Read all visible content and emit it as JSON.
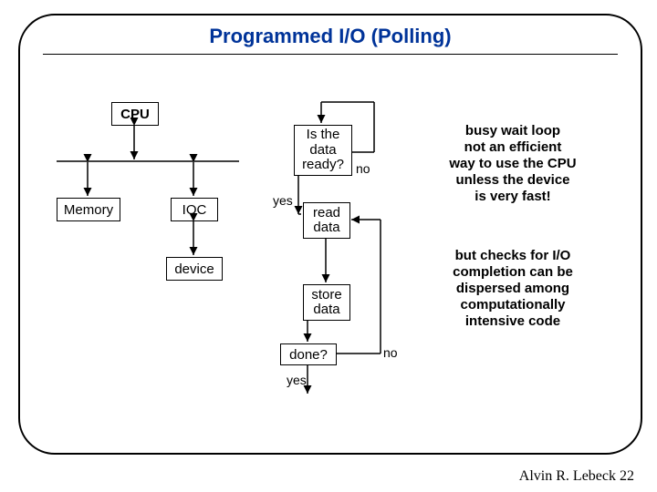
{
  "title": "Programmed I/O (Polling)",
  "blocks": {
    "cpu": "CPU",
    "memory": "Memory",
    "ioc": "IOC",
    "device": "device"
  },
  "flow": {
    "q1": "Is the\ndata\nready?",
    "read": "read\ndata",
    "store": "store\ndata",
    "done": "done?"
  },
  "labels": {
    "yes1": "yes",
    "no1": "no",
    "yes2": "yes",
    "no2": "no"
  },
  "annotations": {
    "a1": "busy wait loop\nnot an efficient\nway to use the CPU\nunless the device\nis very fast!",
    "a2": "but checks for I/O\ncompletion can be\ndispersed among\ncomputationally\nintensive code"
  },
  "footer": "Alvin R. Lebeck 22"
}
